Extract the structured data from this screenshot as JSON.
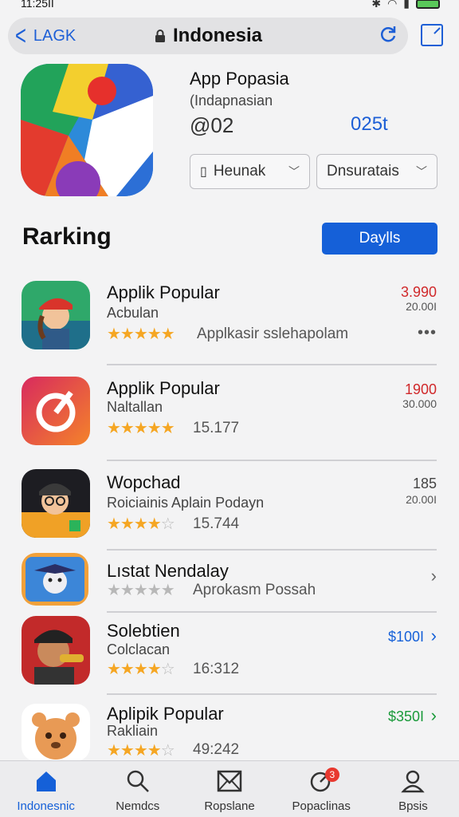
{
  "status": {
    "time": "11:25II"
  },
  "nav": {
    "back_label": "LAGK",
    "url": "Indonesia"
  },
  "app": {
    "title": "App Popasia",
    "subtitle": "(Indapnasian",
    "stat": "@02",
    "price": "025t",
    "dropdown1": "Heunak",
    "dropdown2": "Dnsuratais"
  },
  "ranking": {
    "title": "Rarking",
    "daily_label": "Daylls",
    "items": [
      {
        "name": "Applik Popular",
        "category": "Acbulan",
        "stars": 5,
        "meta": "Applkasir sslehapolam",
        "price": "3.990",
        "price_color": "#d0282a",
        "sub": "20.00I"
      },
      {
        "name": "Applik Popular",
        "category": "Naltallan",
        "stars": 5,
        "meta": "15.177",
        "price": "1900",
        "price_color": "#d0282a",
        "sub": "30.000"
      },
      {
        "name": "Wopchad",
        "category": "Roiciainis Aplain Podayn",
        "stars": 4,
        "meta": "15.744",
        "price": "185",
        "price_color": "#444444",
        "sub": "20.00I"
      },
      {
        "name": "Lıstat Nendalay",
        "category": "",
        "stars": 0,
        "meta": "Aprokasm Possah",
        "price": "",
        "price_color": "#444444",
        "sub": ""
      },
      {
        "name": "Solebtien",
        "category": "Colclacan",
        "stars": 4,
        "meta": "16:312",
        "price": "$100I",
        "price_color": "#1560d8",
        "sub": ""
      },
      {
        "name": "Aplipik Popular",
        "category": "Rakliain",
        "stars": 4,
        "meta": "49:242",
        "price": "$350I",
        "price_color": "#1a9a3a",
        "sub": ""
      }
    ]
  },
  "tabs": [
    {
      "label": "Indonesnic",
      "icon": "home-icon"
    },
    {
      "label": "Nemdcs",
      "icon": "search-icon"
    },
    {
      "label": "Ropslane",
      "icon": "mail-icon"
    },
    {
      "label": "Popaclinas",
      "icon": "updates-icon",
      "badge": "3"
    },
    {
      "label": "Bpsis",
      "icon": "profile-icon"
    }
  ]
}
